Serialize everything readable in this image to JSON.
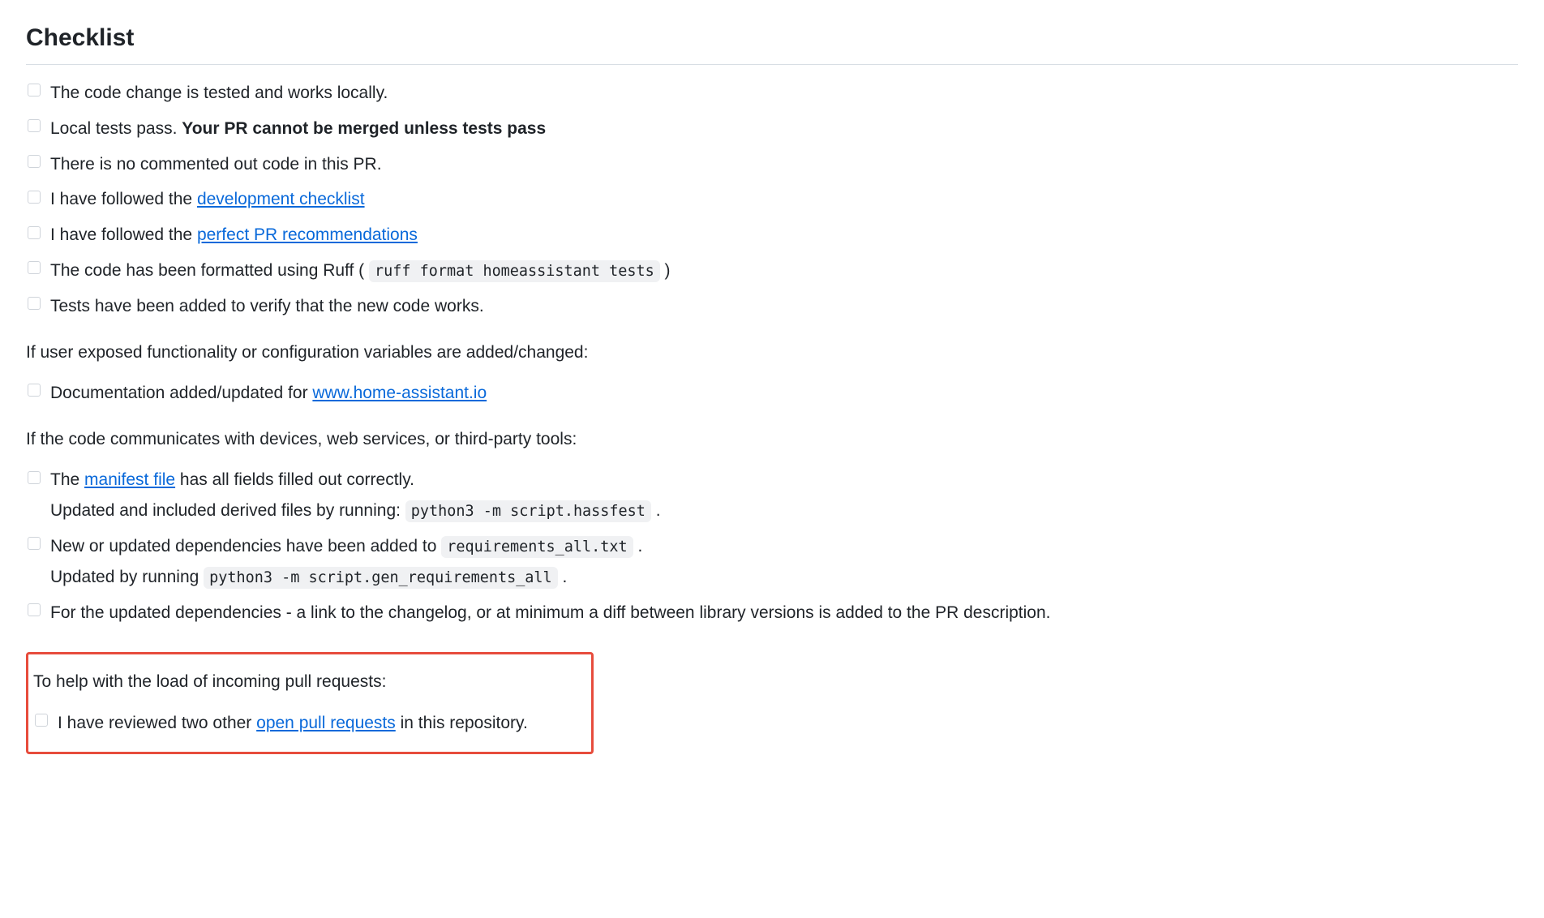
{
  "heading": "Checklist",
  "list1": {
    "item0": "The code change is tested and works locally.",
    "item1_pre": "Local tests pass. ",
    "item1_strong": "Your PR cannot be merged unless tests pass",
    "item2": "There is no commented out code in this PR.",
    "item3_pre": "I have followed the ",
    "item3_link": "development checklist",
    "item4_pre": "I have followed the ",
    "item4_link": "perfect PR recommendations",
    "item5_pre": "The code has been formatted using Ruff ( ",
    "item5_code": "ruff format homeassistant tests",
    "item5_post": " )",
    "item6": "Tests have been added to verify that the new code works."
  },
  "section2_text": "If user exposed functionality or configuration variables are added/changed:",
  "list2": {
    "item0_pre": "Documentation added/updated for ",
    "item0_link": "www.home-assistant.io"
  },
  "section3_text": "If the code communicates with devices, web services, or third-party tools:",
  "list3": {
    "item0_pre": "The ",
    "item0_link": "manifest file",
    "item0_post": " has all fields filled out correctly.",
    "item0_line2_pre": "Updated and included derived files by running: ",
    "item0_line2_code": "python3 -m script.hassfest",
    "item0_line2_post": " .",
    "item1_pre": "New or updated dependencies have been added to ",
    "item1_code": "requirements_all.txt",
    "item1_post": " .",
    "item1_line2_pre": "Updated by running ",
    "item1_line2_code": "python3 -m script.gen_requirements_all",
    "item1_line2_post": " .",
    "item2": "For the updated dependencies - a link to the changelog, or at minimum a diff between library versions is added to the PR description."
  },
  "section4_text": "To help with the load of incoming pull requests:",
  "list4": {
    "item0_pre": "I have reviewed two other ",
    "item0_link": "open pull requests",
    "item0_post": " in this repository."
  }
}
